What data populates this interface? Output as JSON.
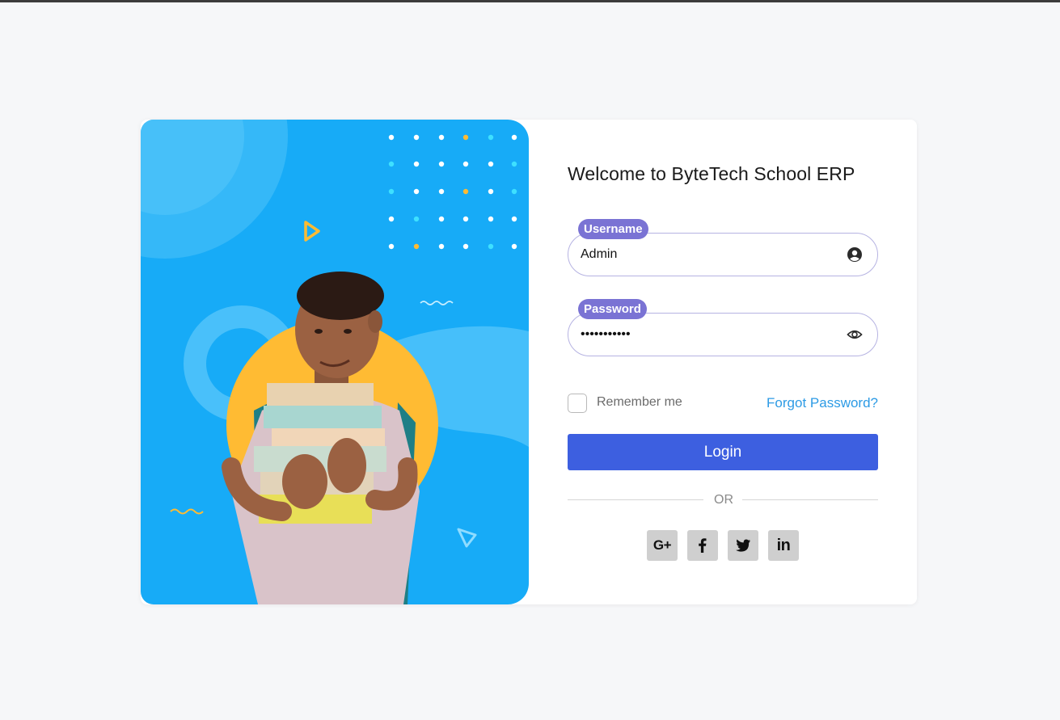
{
  "theme": {
    "hero_background": "#17abf7",
    "accent_yellow": "#ffbb33",
    "label_color": "#7a73d4",
    "login_button_color": "#3d5fe0",
    "link_color": "#2d9be5"
  },
  "hero": {
    "illustration": "student-holding-books-photo",
    "decorations": [
      "dot-grid",
      "triangle-outline-icon",
      "wave-line",
      "yellow-circle"
    ]
  },
  "login_form": {
    "title": "Welcome to ByteTech School ERP",
    "username": {
      "label": "Username",
      "value": "Admin",
      "icon": "user-circle-icon"
    },
    "password": {
      "label": "Password",
      "value": "•••••••••••",
      "icon": "eye-icon"
    },
    "remember_label": "Remember me",
    "remember_checked": false,
    "forgot_label": "Forgot Password?",
    "login_label": "Login",
    "divider_text": "OR",
    "social": [
      {
        "name": "google-plus",
        "label": "G+"
      },
      {
        "name": "facebook",
        "label": ""
      },
      {
        "name": "twitter",
        "label": ""
      },
      {
        "name": "linkedin",
        "label": "in"
      }
    ]
  }
}
